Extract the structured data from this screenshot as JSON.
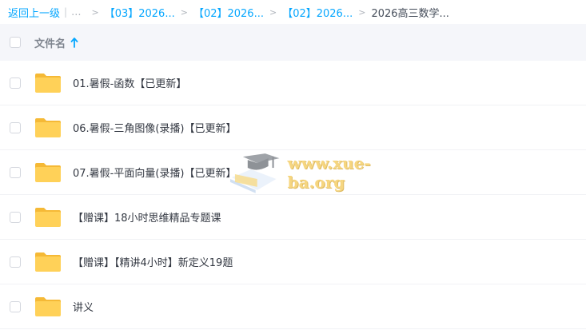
{
  "breadcrumb": {
    "back_label": "返回上一级",
    "pipe": "|",
    "ellipsis": "...",
    "separator": ">",
    "items": [
      {
        "label": "【03】2026..."
      },
      {
        "label": "【02】2026..."
      },
      {
        "label": "【02】2026..."
      }
    ],
    "current": "2026高三数学..."
  },
  "table": {
    "column_name": "文件名",
    "sort": "ascending",
    "rows": [
      {
        "name": "01.暑假-函数【已更新】",
        "icon": "folder-icon"
      },
      {
        "name": "06.暑假-三角图像(录播)【已更新】",
        "icon": "folder-icon"
      },
      {
        "name": "07.暑假-平面向量(录播)【已更新】",
        "icon": "folder-icon"
      },
      {
        "name": "【赠课】18小时思维精品专题课",
        "icon": "folder-icon"
      },
      {
        "name": "【赠课】【精讲4小时】新定义19题",
        "icon": "folder-icon"
      },
      {
        "name": "讲义",
        "icon": "folder-icon"
      }
    ]
  },
  "watermark": {
    "text": "www.xue-ba.org",
    "icon": "graduation-cap-icon"
  },
  "colors": {
    "link": "#06a7ff",
    "folder": "#ffd158",
    "header_bg": "#f5f6fa"
  }
}
